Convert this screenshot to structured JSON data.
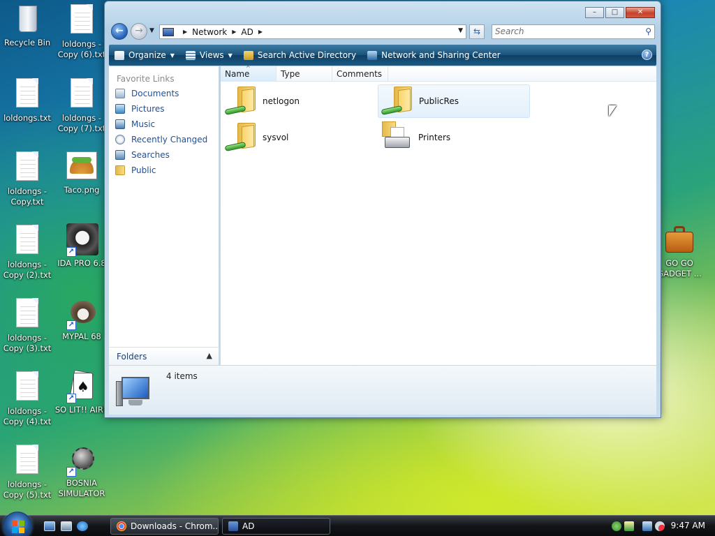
{
  "desktop": {
    "icons": [
      {
        "label": "Recycle Bin"
      },
      {
        "label": "loldongs - Copy (6).txt"
      },
      {
        "label": "loldongs.txt"
      },
      {
        "label": "loldongs - Copy (7).txt"
      },
      {
        "label": "loldongs - Copy.txt"
      },
      {
        "label": "Taco.png"
      },
      {
        "label": "loldongs - Copy (2).txt"
      },
      {
        "label": "IDA PRO 6.8"
      },
      {
        "label": "loldongs - Copy (3).txt"
      },
      {
        "label": "MYPAL 68"
      },
      {
        "label": "loldongs - Copy (4).txt"
      },
      {
        "label": "SO LIT!! AIRE"
      },
      {
        "label": "loldongs - Copy (5).txt"
      },
      {
        "label": "BOSNIA SIMULATOR"
      },
      {
        "label": "GO GO GADGET ..."
      }
    ]
  },
  "window": {
    "caption_buttons": {
      "minimize": "–",
      "maximize": "□",
      "close": "✕"
    },
    "address": {
      "segments": [
        "Network",
        "AD"
      ]
    },
    "search": {
      "placeholder": "Search"
    },
    "toolbar": {
      "organize": "Organize",
      "views": "Views",
      "search_ad": "Search Active Directory",
      "network_center": "Network and Sharing Center"
    },
    "nav": {
      "header": "Favorite Links",
      "links": [
        "Documents",
        "Pictures",
        "Music",
        "Recently Changed",
        "Searches",
        "Public"
      ],
      "folders_label": "Folders"
    },
    "columns": [
      "Name",
      "Type",
      "Comments"
    ],
    "items": [
      {
        "name": "netlogon",
        "kind": "share"
      },
      {
        "name": "PublicRes",
        "kind": "share"
      },
      {
        "name": "sysvol",
        "kind": "share"
      },
      {
        "name": "Printers",
        "kind": "printers"
      }
    ],
    "details": {
      "count_text": "4 items"
    }
  },
  "taskbar": {
    "buttons": [
      {
        "label": "Downloads - Chrom..."
      },
      {
        "label": "AD"
      }
    ],
    "clock": "9:47 AM"
  },
  "colors": {
    "link_blue": "#1e4f9b",
    "toolbar_dark": "#19527a",
    "close_red": "#c8412a"
  }
}
